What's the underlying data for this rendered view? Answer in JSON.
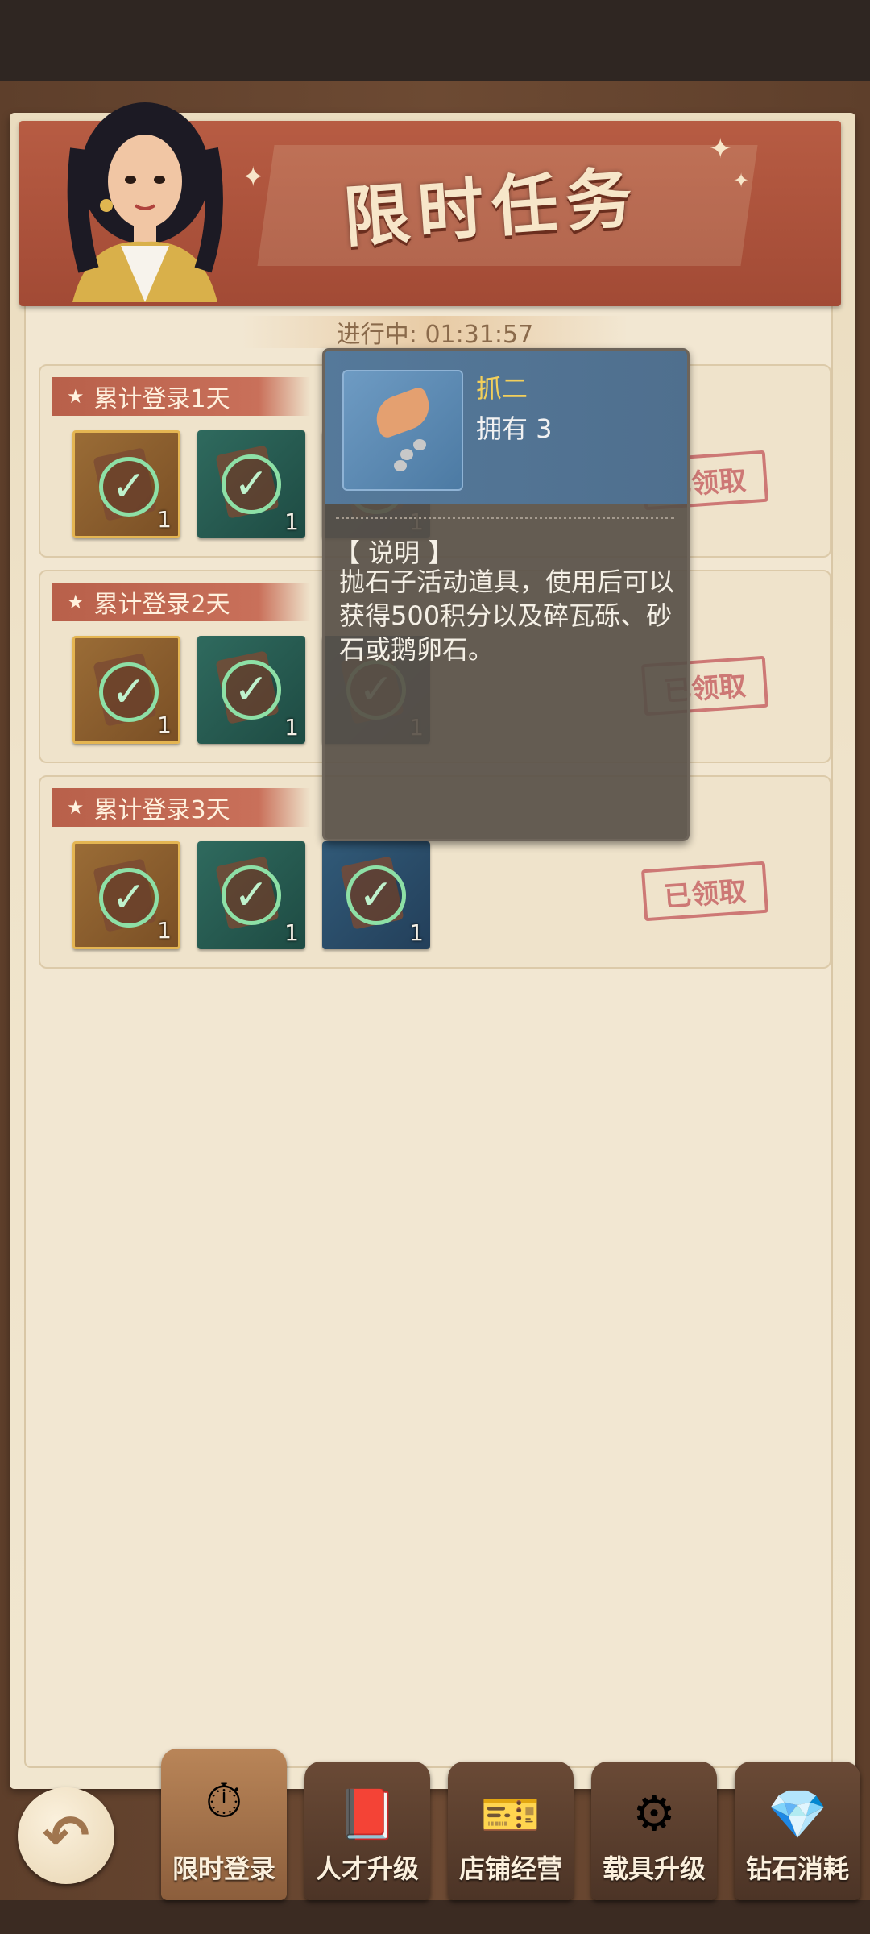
{
  "header": {
    "title": "限时任务",
    "timer_label": "进行中: 01:31:57"
  },
  "tasks": [
    {
      "label": "累计登录1天",
      "rewards": [
        {
          "style": "gold",
          "count": "1"
        },
        {
          "style": "green",
          "count": "1"
        },
        {
          "style": "blue",
          "count": "1"
        }
      ],
      "status": "已领取"
    },
    {
      "label": "累计登录2天",
      "rewards": [
        {
          "style": "gold",
          "count": "1"
        },
        {
          "style": "green",
          "count": "1"
        },
        {
          "style": "blue",
          "count": "1"
        }
      ],
      "status": "已领取"
    },
    {
      "label": "累计登录3天",
      "rewards": [
        {
          "style": "gold",
          "count": "1"
        },
        {
          "style": "green",
          "count": "1"
        },
        {
          "style": "blue",
          "count": "1"
        }
      ],
      "status": "已领取"
    }
  ],
  "tooltip": {
    "item_name": "抓二",
    "owned": "拥有 3",
    "desc_title": "【 说明 】",
    "desc": "抛石子活动道具，使用后可以获得500积分以及碎瓦砾、砂石或鹅卵石。"
  },
  "tabs": [
    {
      "label": "限时登录",
      "icon": "stopwatch-icon",
      "active": true
    },
    {
      "label": "人才升级",
      "icon": "book-icon",
      "active": false
    },
    {
      "label": "店铺经营",
      "icon": "shop-ticket-icon",
      "active": false
    },
    {
      "label": "载具升级",
      "icon": "gear-icon",
      "active": false
    },
    {
      "label": "钻石消耗",
      "icon": "diamond-icon",
      "active": false
    }
  ],
  "colors": {
    "accent_red": "#b75c43",
    "gold_text": "#f2cf5b",
    "stamp_red": "#c86667"
  }
}
